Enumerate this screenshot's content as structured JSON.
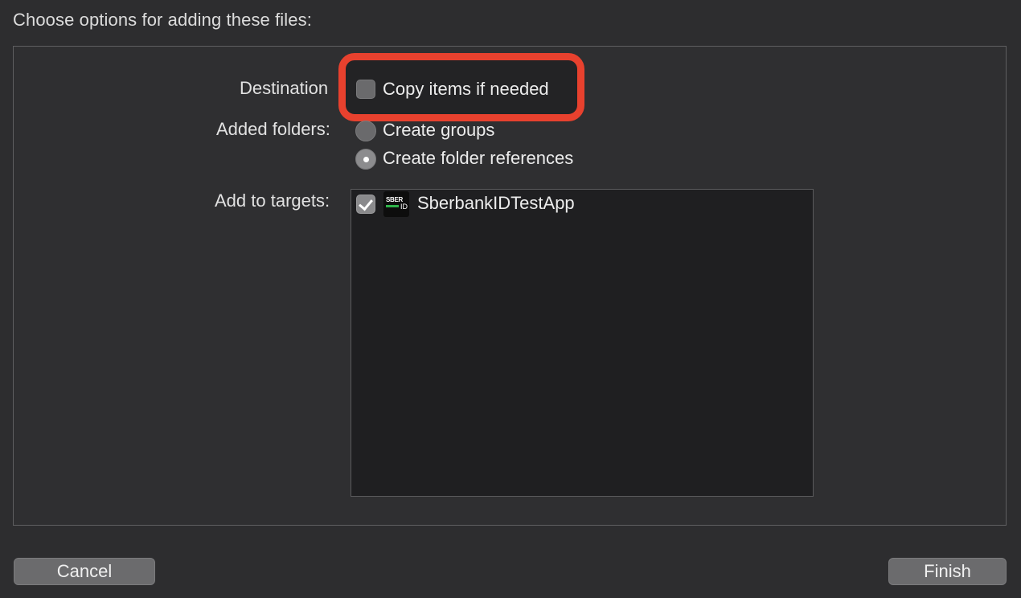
{
  "dialog": {
    "header": "Choose options for adding these files:"
  },
  "destination": {
    "label": "Destination",
    "option_label": "Copy items if needed",
    "checked": false
  },
  "added_folders": {
    "label": "Added folders:",
    "options": [
      {
        "label": "Create groups",
        "selected": false
      },
      {
        "label": "Create folder references",
        "selected": true
      }
    ]
  },
  "targets": {
    "label": "Add to targets:",
    "items": [
      {
        "name": "SberbankIDTestApp",
        "checked": true,
        "icon": "sberbank-id-app-icon",
        "icon_text_top": "SBER",
        "icon_text_id": "ID"
      }
    ]
  },
  "buttons": {
    "cancel": "Cancel",
    "finish": "Finish"
  },
  "colors": {
    "highlight": "#e8412e",
    "icon_bar": "#2fb34a"
  }
}
